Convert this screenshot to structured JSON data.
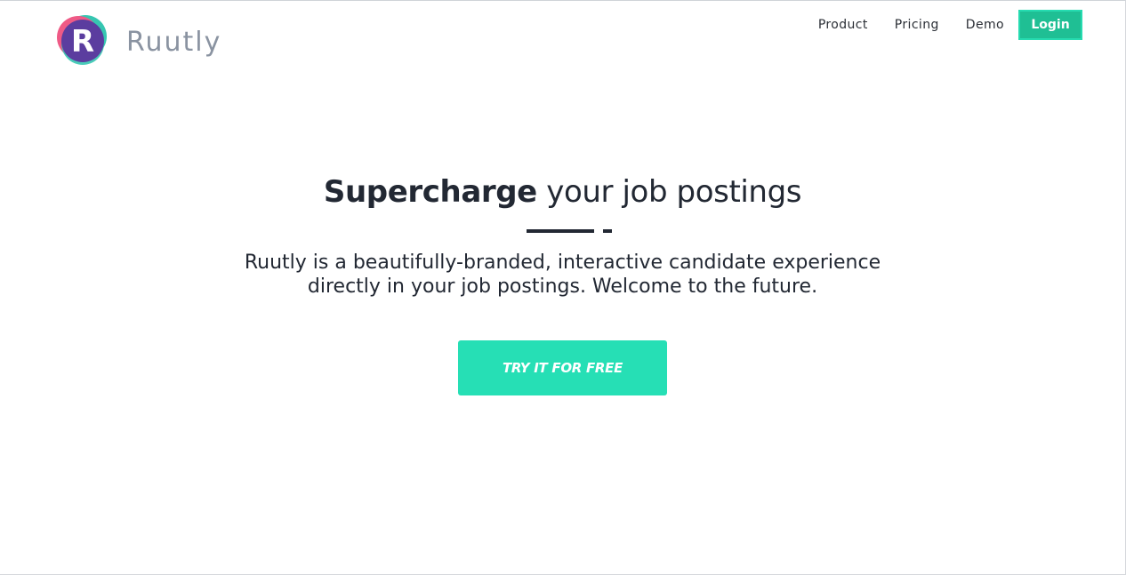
{
  "brand": {
    "name": "Ruutly",
    "logo_letter": "R",
    "colors": {
      "purple": "#5b3d9f",
      "pink": "#ef5a86",
      "teal": "#36c6b1",
      "wordmark": "#8a93a1"
    }
  },
  "nav": {
    "items": [
      {
        "label": "Product"
      },
      {
        "label": "Pricing"
      },
      {
        "label": "Demo"
      }
    ],
    "login_label": "Login",
    "login_color": "#1fbf94"
  },
  "hero": {
    "headline_strong": "Supercharge",
    "headline_rest": " your job postings",
    "subtitle_line1": "Ruutly is a beautifully-branded, interactive candidate experience",
    "subtitle_line2": "directly in your job postings. Welcome to the future.",
    "cta_label": "TRY IT FOR FREE",
    "cta_color": "#26dfb5"
  }
}
